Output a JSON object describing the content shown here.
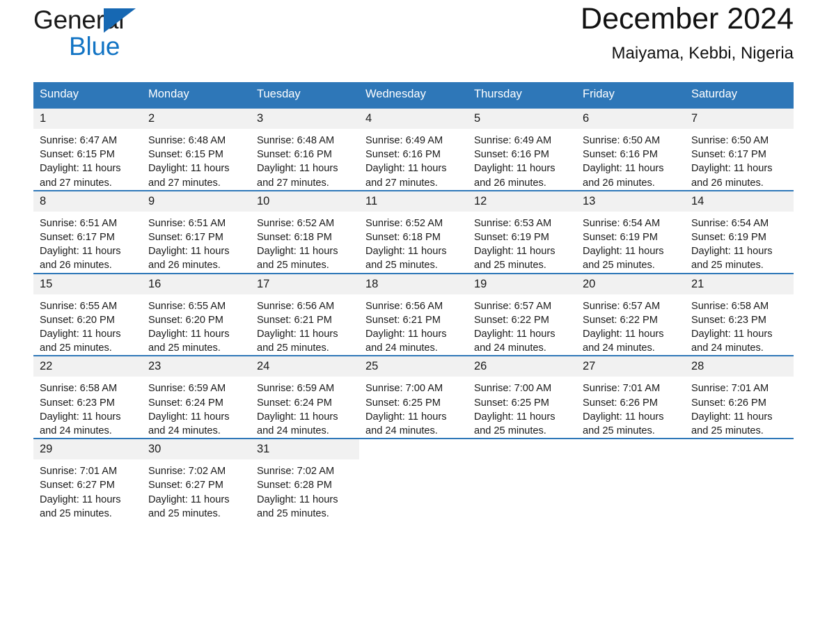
{
  "brand": {
    "name_part1": "General",
    "name_part2": "Blue",
    "triangle_color": "#1668b3",
    "blue_color": "#1274c4"
  },
  "header": {
    "title": "December 2024",
    "subtitle": "Maiyama, Kebbi, Nigeria"
  },
  "theme": {
    "header_blue": "#2e77b8",
    "daynum_band": "#f1f1f1",
    "text": "#1a1a1a"
  },
  "weekday_headers": [
    "Sunday",
    "Monday",
    "Tuesday",
    "Wednesday",
    "Thursday",
    "Friday",
    "Saturday"
  ],
  "labels": {
    "sunrise_prefix": "Sunrise:",
    "sunset_prefix": "Sunset:",
    "daylight_prefix": "Daylight:"
  },
  "weeks": [
    [
      {
        "day": "1",
        "sunrise": "Sunrise: 6:47 AM",
        "sunset": "Sunset: 6:15 PM",
        "daylight_l1": "Daylight: 11 hours",
        "daylight_l2": "and 27 minutes."
      },
      {
        "day": "2",
        "sunrise": "Sunrise: 6:48 AM",
        "sunset": "Sunset: 6:15 PM",
        "daylight_l1": "Daylight: 11 hours",
        "daylight_l2": "and 27 minutes."
      },
      {
        "day": "3",
        "sunrise": "Sunrise: 6:48 AM",
        "sunset": "Sunset: 6:16 PM",
        "daylight_l1": "Daylight: 11 hours",
        "daylight_l2": "and 27 minutes."
      },
      {
        "day": "4",
        "sunrise": "Sunrise: 6:49 AM",
        "sunset": "Sunset: 6:16 PM",
        "daylight_l1": "Daylight: 11 hours",
        "daylight_l2": "and 27 minutes."
      },
      {
        "day": "5",
        "sunrise": "Sunrise: 6:49 AM",
        "sunset": "Sunset: 6:16 PM",
        "daylight_l1": "Daylight: 11 hours",
        "daylight_l2": "and 26 minutes."
      },
      {
        "day": "6",
        "sunrise": "Sunrise: 6:50 AM",
        "sunset": "Sunset: 6:16 PM",
        "daylight_l1": "Daylight: 11 hours",
        "daylight_l2": "and 26 minutes."
      },
      {
        "day": "7",
        "sunrise": "Sunrise: 6:50 AM",
        "sunset": "Sunset: 6:17 PM",
        "daylight_l1": "Daylight: 11 hours",
        "daylight_l2": "and 26 minutes."
      }
    ],
    [
      {
        "day": "8",
        "sunrise": "Sunrise: 6:51 AM",
        "sunset": "Sunset: 6:17 PM",
        "daylight_l1": "Daylight: 11 hours",
        "daylight_l2": "and 26 minutes."
      },
      {
        "day": "9",
        "sunrise": "Sunrise: 6:51 AM",
        "sunset": "Sunset: 6:17 PM",
        "daylight_l1": "Daylight: 11 hours",
        "daylight_l2": "and 26 minutes."
      },
      {
        "day": "10",
        "sunrise": "Sunrise: 6:52 AM",
        "sunset": "Sunset: 6:18 PM",
        "daylight_l1": "Daylight: 11 hours",
        "daylight_l2": "and 25 minutes."
      },
      {
        "day": "11",
        "sunrise": "Sunrise: 6:52 AM",
        "sunset": "Sunset: 6:18 PM",
        "daylight_l1": "Daylight: 11 hours",
        "daylight_l2": "and 25 minutes."
      },
      {
        "day": "12",
        "sunrise": "Sunrise: 6:53 AM",
        "sunset": "Sunset: 6:19 PM",
        "daylight_l1": "Daylight: 11 hours",
        "daylight_l2": "and 25 minutes."
      },
      {
        "day": "13",
        "sunrise": "Sunrise: 6:54 AM",
        "sunset": "Sunset: 6:19 PM",
        "daylight_l1": "Daylight: 11 hours",
        "daylight_l2": "and 25 minutes."
      },
      {
        "day": "14",
        "sunrise": "Sunrise: 6:54 AM",
        "sunset": "Sunset: 6:19 PM",
        "daylight_l1": "Daylight: 11 hours",
        "daylight_l2": "and 25 minutes."
      }
    ],
    [
      {
        "day": "15",
        "sunrise": "Sunrise: 6:55 AM",
        "sunset": "Sunset: 6:20 PM",
        "daylight_l1": "Daylight: 11 hours",
        "daylight_l2": "and 25 minutes."
      },
      {
        "day": "16",
        "sunrise": "Sunrise: 6:55 AM",
        "sunset": "Sunset: 6:20 PM",
        "daylight_l1": "Daylight: 11 hours",
        "daylight_l2": "and 25 minutes."
      },
      {
        "day": "17",
        "sunrise": "Sunrise: 6:56 AM",
        "sunset": "Sunset: 6:21 PM",
        "daylight_l1": "Daylight: 11 hours",
        "daylight_l2": "and 25 minutes."
      },
      {
        "day": "18",
        "sunrise": "Sunrise: 6:56 AM",
        "sunset": "Sunset: 6:21 PM",
        "daylight_l1": "Daylight: 11 hours",
        "daylight_l2": "and 24 minutes."
      },
      {
        "day": "19",
        "sunrise": "Sunrise: 6:57 AM",
        "sunset": "Sunset: 6:22 PM",
        "daylight_l1": "Daylight: 11 hours",
        "daylight_l2": "and 24 minutes."
      },
      {
        "day": "20",
        "sunrise": "Sunrise: 6:57 AM",
        "sunset": "Sunset: 6:22 PM",
        "daylight_l1": "Daylight: 11 hours",
        "daylight_l2": "and 24 minutes."
      },
      {
        "day": "21",
        "sunrise": "Sunrise: 6:58 AM",
        "sunset": "Sunset: 6:23 PM",
        "daylight_l1": "Daylight: 11 hours",
        "daylight_l2": "and 24 minutes."
      }
    ],
    [
      {
        "day": "22",
        "sunrise": "Sunrise: 6:58 AM",
        "sunset": "Sunset: 6:23 PM",
        "daylight_l1": "Daylight: 11 hours",
        "daylight_l2": "and 24 minutes."
      },
      {
        "day": "23",
        "sunrise": "Sunrise: 6:59 AM",
        "sunset": "Sunset: 6:24 PM",
        "daylight_l1": "Daylight: 11 hours",
        "daylight_l2": "and 24 minutes."
      },
      {
        "day": "24",
        "sunrise": "Sunrise: 6:59 AM",
        "sunset": "Sunset: 6:24 PM",
        "daylight_l1": "Daylight: 11 hours",
        "daylight_l2": "and 24 minutes."
      },
      {
        "day": "25",
        "sunrise": "Sunrise: 7:00 AM",
        "sunset": "Sunset: 6:25 PM",
        "daylight_l1": "Daylight: 11 hours",
        "daylight_l2": "and 24 minutes."
      },
      {
        "day": "26",
        "sunrise": "Sunrise: 7:00 AM",
        "sunset": "Sunset: 6:25 PM",
        "daylight_l1": "Daylight: 11 hours",
        "daylight_l2": "and 25 minutes."
      },
      {
        "day": "27",
        "sunrise": "Sunrise: 7:01 AM",
        "sunset": "Sunset: 6:26 PM",
        "daylight_l1": "Daylight: 11 hours",
        "daylight_l2": "and 25 minutes."
      },
      {
        "day": "28",
        "sunrise": "Sunrise: 7:01 AM",
        "sunset": "Sunset: 6:26 PM",
        "daylight_l1": "Daylight: 11 hours",
        "daylight_l2": "and 25 minutes."
      }
    ],
    [
      {
        "day": "29",
        "sunrise": "Sunrise: 7:01 AM",
        "sunset": "Sunset: 6:27 PM",
        "daylight_l1": "Daylight: 11 hours",
        "daylight_l2": "and 25 minutes."
      },
      {
        "day": "30",
        "sunrise": "Sunrise: 7:02 AM",
        "sunset": "Sunset: 6:27 PM",
        "daylight_l1": "Daylight: 11 hours",
        "daylight_l2": "and 25 minutes."
      },
      {
        "day": "31",
        "sunrise": "Sunrise: 7:02 AM",
        "sunset": "Sunset: 6:28 PM",
        "daylight_l1": "Daylight: 11 hours",
        "daylight_l2": "and 25 minutes."
      },
      {
        "day": "",
        "sunrise": "",
        "sunset": "",
        "daylight_l1": "",
        "daylight_l2": ""
      },
      {
        "day": "",
        "sunrise": "",
        "sunset": "",
        "daylight_l1": "",
        "daylight_l2": ""
      },
      {
        "day": "",
        "sunrise": "",
        "sunset": "",
        "daylight_l1": "",
        "daylight_l2": ""
      },
      {
        "day": "",
        "sunrise": "",
        "sunset": "",
        "daylight_l1": "",
        "daylight_l2": ""
      }
    ]
  ]
}
